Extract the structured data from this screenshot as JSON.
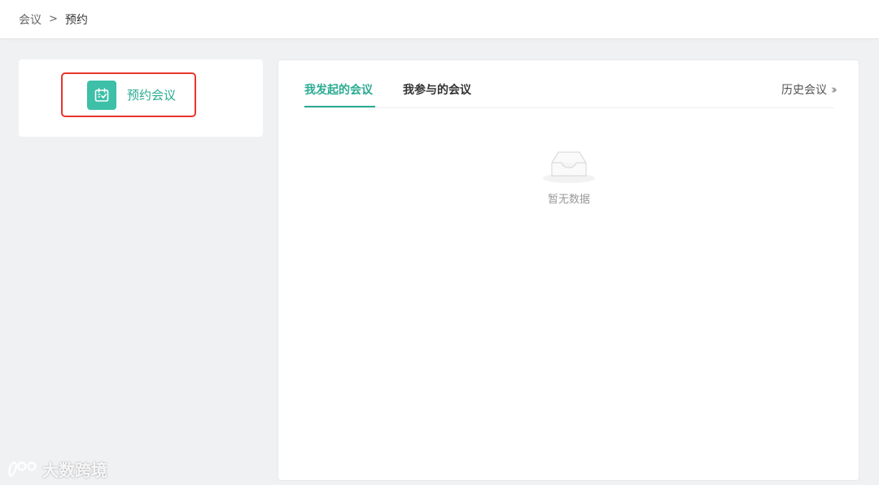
{
  "breadcrumb": {
    "root": "会议",
    "separator": ">",
    "current": "预约"
  },
  "sidebar": {
    "book_meeting_label": "预约会议",
    "icon": "calendar-check-icon"
  },
  "main": {
    "tabs": [
      {
        "label": "我发起的会议",
        "active": true
      },
      {
        "label": "我参与的会议",
        "active": false
      }
    ],
    "history_link": "历史会议",
    "empty_text": "暂无数据"
  },
  "watermark": {
    "text": "大数跨境"
  },
  "colors": {
    "accent": "#2bab92",
    "icon_bg": "#3dbfa8",
    "highlight_border": "#e8362a",
    "page_bg": "#f0f1f3"
  }
}
